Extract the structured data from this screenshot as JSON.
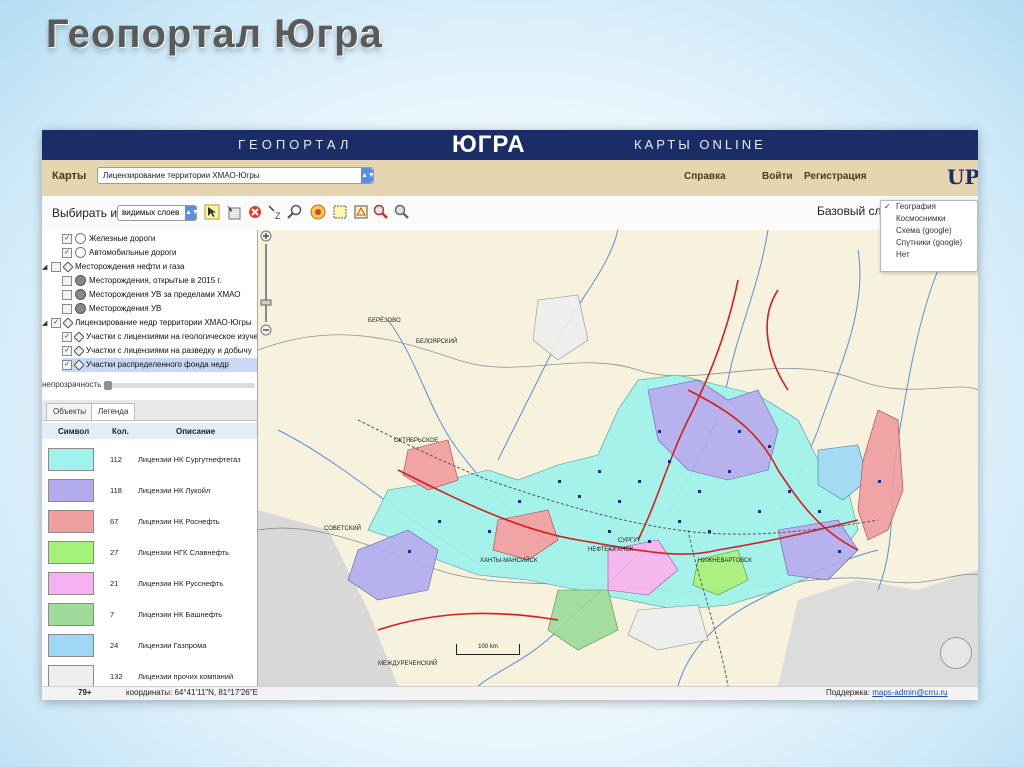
{
  "slide": {
    "title": "Геопортал Югра"
  },
  "banner": {
    "left": "ГЕОПОРТАЛ",
    "center": "ЮГРА",
    "right": "КАРТЫ ONLINE"
  },
  "menubar": {
    "maps_label": "Карты",
    "map_select": "Лицензирование территории ХМАО-Югры",
    "help": "Справка",
    "login": "Войти",
    "register": "Регистрация",
    "logo": "UPH"
  },
  "toolbar": {
    "choose_from": "Выбирать из",
    "layer_scope": "видимых слоев",
    "base_layer_label": "Базовый слой"
  },
  "base_layers": {
    "options": [
      "География",
      "Космоснимки",
      "Схема (google)",
      "Спутники (google)",
      "Нет"
    ],
    "selected": "География"
  },
  "layers": {
    "items": [
      {
        "label": "Железные дороги"
      },
      {
        "label": "Автомобильные дороги"
      },
      {
        "label": "Месторождения нефти и газа"
      },
      {
        "label": "Месторождения, открытые в 2015 г."
      },
      {
        "label": "Месторождения УВ за пределами ХМАО"
      },
      {
        "label": "Месторождения УВ"
      },
      {
        "label": "Лицензирование недр территории ХМАО-Югры"
      },
      {
        "label": "Участки с лицензиями на геологическое изучение"
      },
      {
        "label": "Участки с лицензиями на разведку и добычу"
      },
      {
        "label": "Участки распределенного фонда недр"
      }
    ],
    "opacity_label": "непрозрачность"
  },
  "tabs": {
    "objects": "Объекты",
    "legend": "Легенда"
  },
  "legend": {
    "headers": {
      "symbol": "Символ",
      "count": "Кол.",
      "description": "Описание"
    },
    "rows": [
      {
        "count": "112",
        "description": "Лицензии НК Сургутнефтегаз",
        "color": "#9ff3ec"
      },
      {
        "count": "118",
        "description": "Лицензии НК Лукойл",
        "color": "#b2acef"
      },
      {
        "count": "67",
        "description": "Лицензии НК Роснефть",
        "color": "#f19ea1"
      },
      {
        "count": "27",
        "description": "Лицензии НГК Славнефть",
        "color": "#a6f07c"
      },
      {
        "count": "21",
        "description": "Лицензии НК Русснефть",
        "color": "#f4b2f0"
      },
      {
        "count": "7",
        "description": "Лицензии НК Башнефть",
        "color": "#9fdb9b"
      },
      {
        "count": "24",
        "description": "Лицензии Газпрома",
        "color": "#9ed8f4"
      },
      {
        "count": "132",
        "description": "Лицензии прочих компаний",
        "color": "#eeeeee"
      }
    ]
  },
  "status": {
    "zoom": "79+",
    "coords": "координаты: 64°41'11\"N, 81°17'26\"E",
    "support_label": "Поддержка:",
    "support_email": "maps-admin@crru.ru"
  },
  "map": {
    "scale_label": "100 km",
    "cities": [
      "БЕРЁЗОВО",
      "БЕЛОЯРСКИЙ",
      "ОКТЯБРЬСКОЕ",
      "СОВЕТСКИЙ",
      "ХАНТЫ-МАНСИЙСК",
      "НЕФТЕЮГАНСК",
      "СУРГУТ",
      "НИЖНЕВАРТОВСК",
      "МЕЖДУРЕЧЕНСКИЙ"
    ]
  }
}
